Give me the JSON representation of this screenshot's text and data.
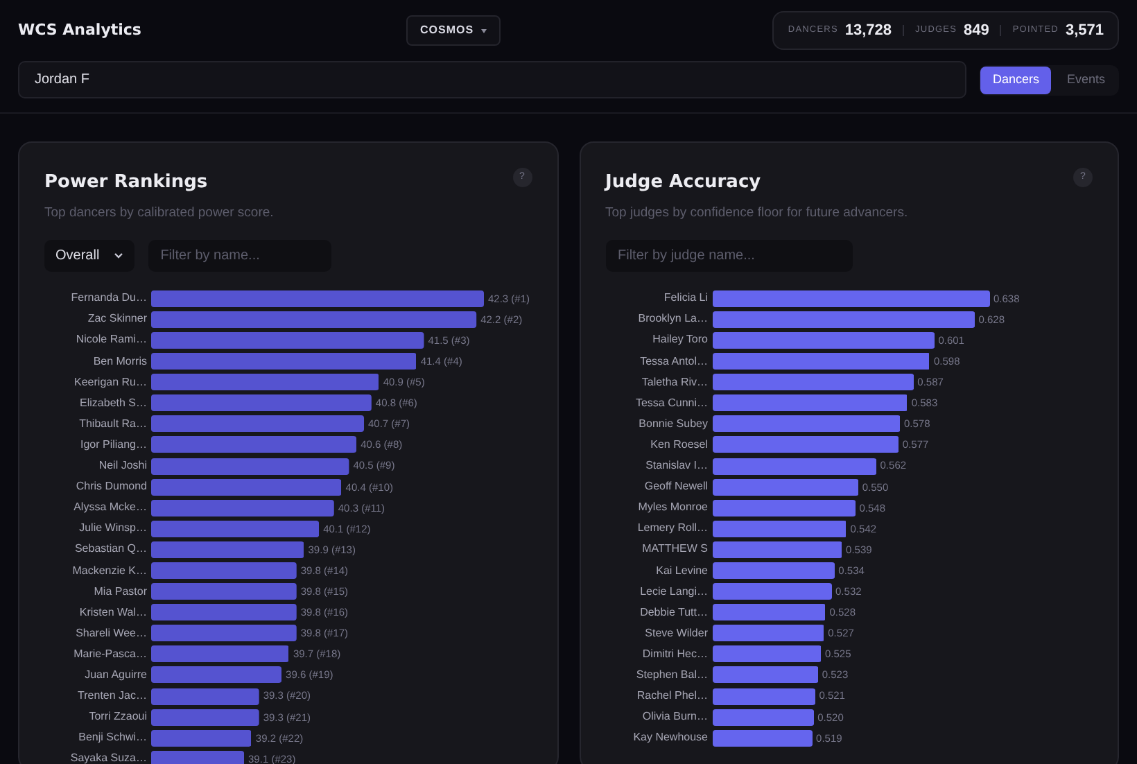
{
  "app": {
    "title": "WCS Analytics",
    "scope_button": "COSMOS"
  },
  "stats": [
    {
      "label": "DANCERS",
      "value": "13,728"
    },
    {
      "label": "JUDGES",
      "value": "849"
    },
    {
      "label": "POINTED",
      "value": "3,571"
    }
  ],
  "search": {
    "value": "Jordan F"
  },
  "tabs": [
    {
      "label": "Dancers",
      "selected": true
    },
    {
      "label": "Events",
      "selected": false
    }
  ],
  "panels": [
    {
      "title": "Power Rankings",
      "subtitle": "Top dancers by calibrated power score.",
      "help": "?",
      "dropdown": "Overall",
      "filter": {
        "placeholder": "Filter by name..."
      },
      "chart_data": {
        "type": "bar",
        "orientation": "horizontal",
        "xlim": [
          37.86,
          42.3
        ],
        "categories": [
          "Fernanda Du…",
          "Zac Skinner",
          "Nicole Rami…",
          "Ben Morris",
          "Keerigan Ru…",
          "Elizabeth S…",
          "Thibault Ra…",
          "Igor Piliang…",
          "Neil Joshi",
          "Chris Dumond",
          "Alyssa Mcke…",
          "Julie Winsp…",
          "Sebastian Q…",
          "Mackenzie K…",
          "Mia Pastor",
          "Kristen Wal…",
          "Shareli Wee…",
          "Marie-Pasca…",
          "Juan Aguirre",
          "Trenten Jac…",
          "Torri Zzaoui",
          "Benji Schwi…",
          "Sayaka Suza…"
        ],
        "values": [
          42.3,
          42.2,
          41.5,
          41.4,
          40.9,
          40.8,
          40.7,
          40.6,
          40.5,
          40.4,
          40.3,
          40.1,
          39.9,
          39.8,
          39.8,
          39.8,
          39.8,
          39.7,
          39.6,
          39.3,
          39.3,
          39.2,
          39.1
        ],
        "value_labels": [
          "42.3 (#1)",
          "42.2 (#2)",
          "41.5 (#3)",
          "41.4 (#4)",
          "40.9 (#5)",
          "40.8 (#6)",
          "40.7 (#7)",
          "40.6 (#8)",
          "40.5 (#9)",
          "40.4 (#10)",
          "40.3 (#11)",
          "40.1 (#12)",
          "39.9 (#13)",
          "39.8 (#14)",
          "39.8 (#15)",
          "39.8 (#16)",
          "39.8 (#17)",
          "39.7 (#18)",
          "39.6 (#19)",
          "39.3 (#20)",
          "39.3 (#21)",
          "39.2 (#22)",
          "39.1 (#23)"
        ]
      }
    },
    {
      "title": "Judge Accuracy",
      "subtitle": "Top judges by confidence floor for future advancers.",
      "help": "?",
      "filter": {
        "placeholder": "Filter by judge name..."
      },
      "chart_data": {
        "type": "bar",
        "orientation": "horizontal",
        "xlim": [
          0.452,
          0.638
        ],
        "categories": [
          "Felicia Li",
          "Brooklyn La…",
          "Hailey Toro",
          "Tessa Antol…",
          "Taletha Riv…",
          "Tessa Cunni…",
          "Bonnie Subey",
          "Ken Roesel",
          "Stanislav I…",
          "Geoff Newell",
          "Myles Monroe",
          "Lemery Roll…",
          "MATTHEW S",
          "Kai Levine",
          "Lecie Langi…",
          "Debbie Tutt…",
          "Steve Wilder",
          "Dimitri Hec…",
          "Stephen Bal…",
          "Rachel Phel…",
          "Olivia Burn…",
          "Kay Newhouse"
        ],
        "values": [
          0.638,
          0.628,
          0.601,
          0.598,
          0.587,
          0.583,
          0.578,
          0.577,
          0.562,
          0.55,
          0.548,
          0.542,
          0.539,
          0.534,
          0.532,
          0.528,
          0.527,
          0.525,
          0.523,
          0.521,
          0.52,
          0.519
        ],
        "value_labels": [
          "0.638",
          "0.628",
          "0.601",
          "0.598",
          "0.587",
          "0.583",
          "0.578",
          "0.577",
          "0.562",
          "0.550",
          "0.548",
          "0.542",
          "0.539",
          "0.534",
          "0.532",
          "0.528",
          "0.527",
          "0.525",
          "0.523",
          "0.521",
          "0.520",
          "0.519"
        ]
      }
    }
  ]
}
